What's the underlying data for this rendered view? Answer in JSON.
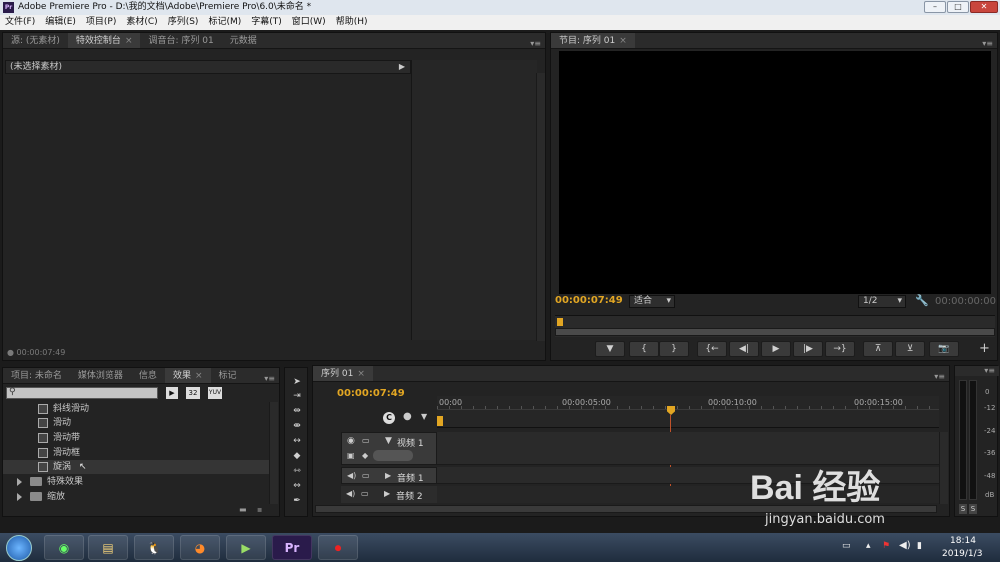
{
  "window": {
    "title": "Adobe Premiere Pro - D:\\我的文档\\Adobe\\Premiere Pro\\6.0\\未命名 *",
    "app_icon": "Pr"
  },
  "menu": [
    "文件(F)",
    "编辑(E)",
    "项目(P)",
    "素材(C)",
    "序列(S)",
    "标记(M)",
    "字幕(T)",
    "窗口(W)",
    "帮助(H)"
  ],
  "source_panel": {
    "tabs": [
      "源: (无素材)",
      "特效控制台",
      "调音台: 序列 01",
      "元数据"
    ],
    "active_tab": 1,
    "header_text": "(未选择素材)",
    "timecode": "00:00:07:49"
  },
  "program_monitor": {
    "tab": "节目: 序列 01",
    "timecode": "00:00:07:49",
    "fit": "适合",
    "resolution": "1/2",
    "end_timecode": "00:00:00:00"
  },
  "project_panel": {
    "tabs": [
      "项目: 未命名",
      "媒体浏览器",
      "信息",
      "效果",
      "标记"
    ],
    "active_tab": 3,
    "search_placeholder": "",
    "badge_32": "32",
    "badge_yuv": "YUV",
    "effects": [
      {
        "label": "斜线滑动",
        "type": "fx"
      },
      {
        "label": "滑动",
        "type": "fx"
      },
      {
        "label": "滑动带",
        "type": "fx"
      },
      {
        "label": "滑动框",
        "type": "fx"
      },
      {
        "label": "旋涡",
        "type": "fx"
      },
      {
        "label": "特殊效果",
        "type": "folder"
      },
      {
        "label": "缩放",
        "type": "folder"
      }
    ]
  },
  "timeline": {
    "tab": "序列 01",
    "timecode": "00:00:07:49",
    "ruler": [
      "00:00",
      "00:00:05:00",
      "00:00:10:00",
      "00:00:15:00"
    ],
    "tracks": [
      {
        "name": "视频 1",
        "kind": "video"
      },
      {
        "name": "音频 1",
        "kind": "audio"
      },
      {
        "name": "音频 2",
        "kind": "audio"
      }
    ]
  },
  "audio_meter": {
    "labels": [
      "0",
      "-12",
      "-24",
      "-36",
      "-48",
      "dB"
    ],
    "solo": [
      "S",
      "S"
    ]
  },
  "taskbar": {
    "time": "18:14",
    "date": "2019/1/3"
  },
  "watermark": {
    "brand": "Bai 经验",
    "url": "jingyan.baidu.com"
  },
  "colors": {
    "accent_timecode": "#e2a623",
    "playhead": "#c0522a",
    "panel_bg": "#232323"
  }
}
